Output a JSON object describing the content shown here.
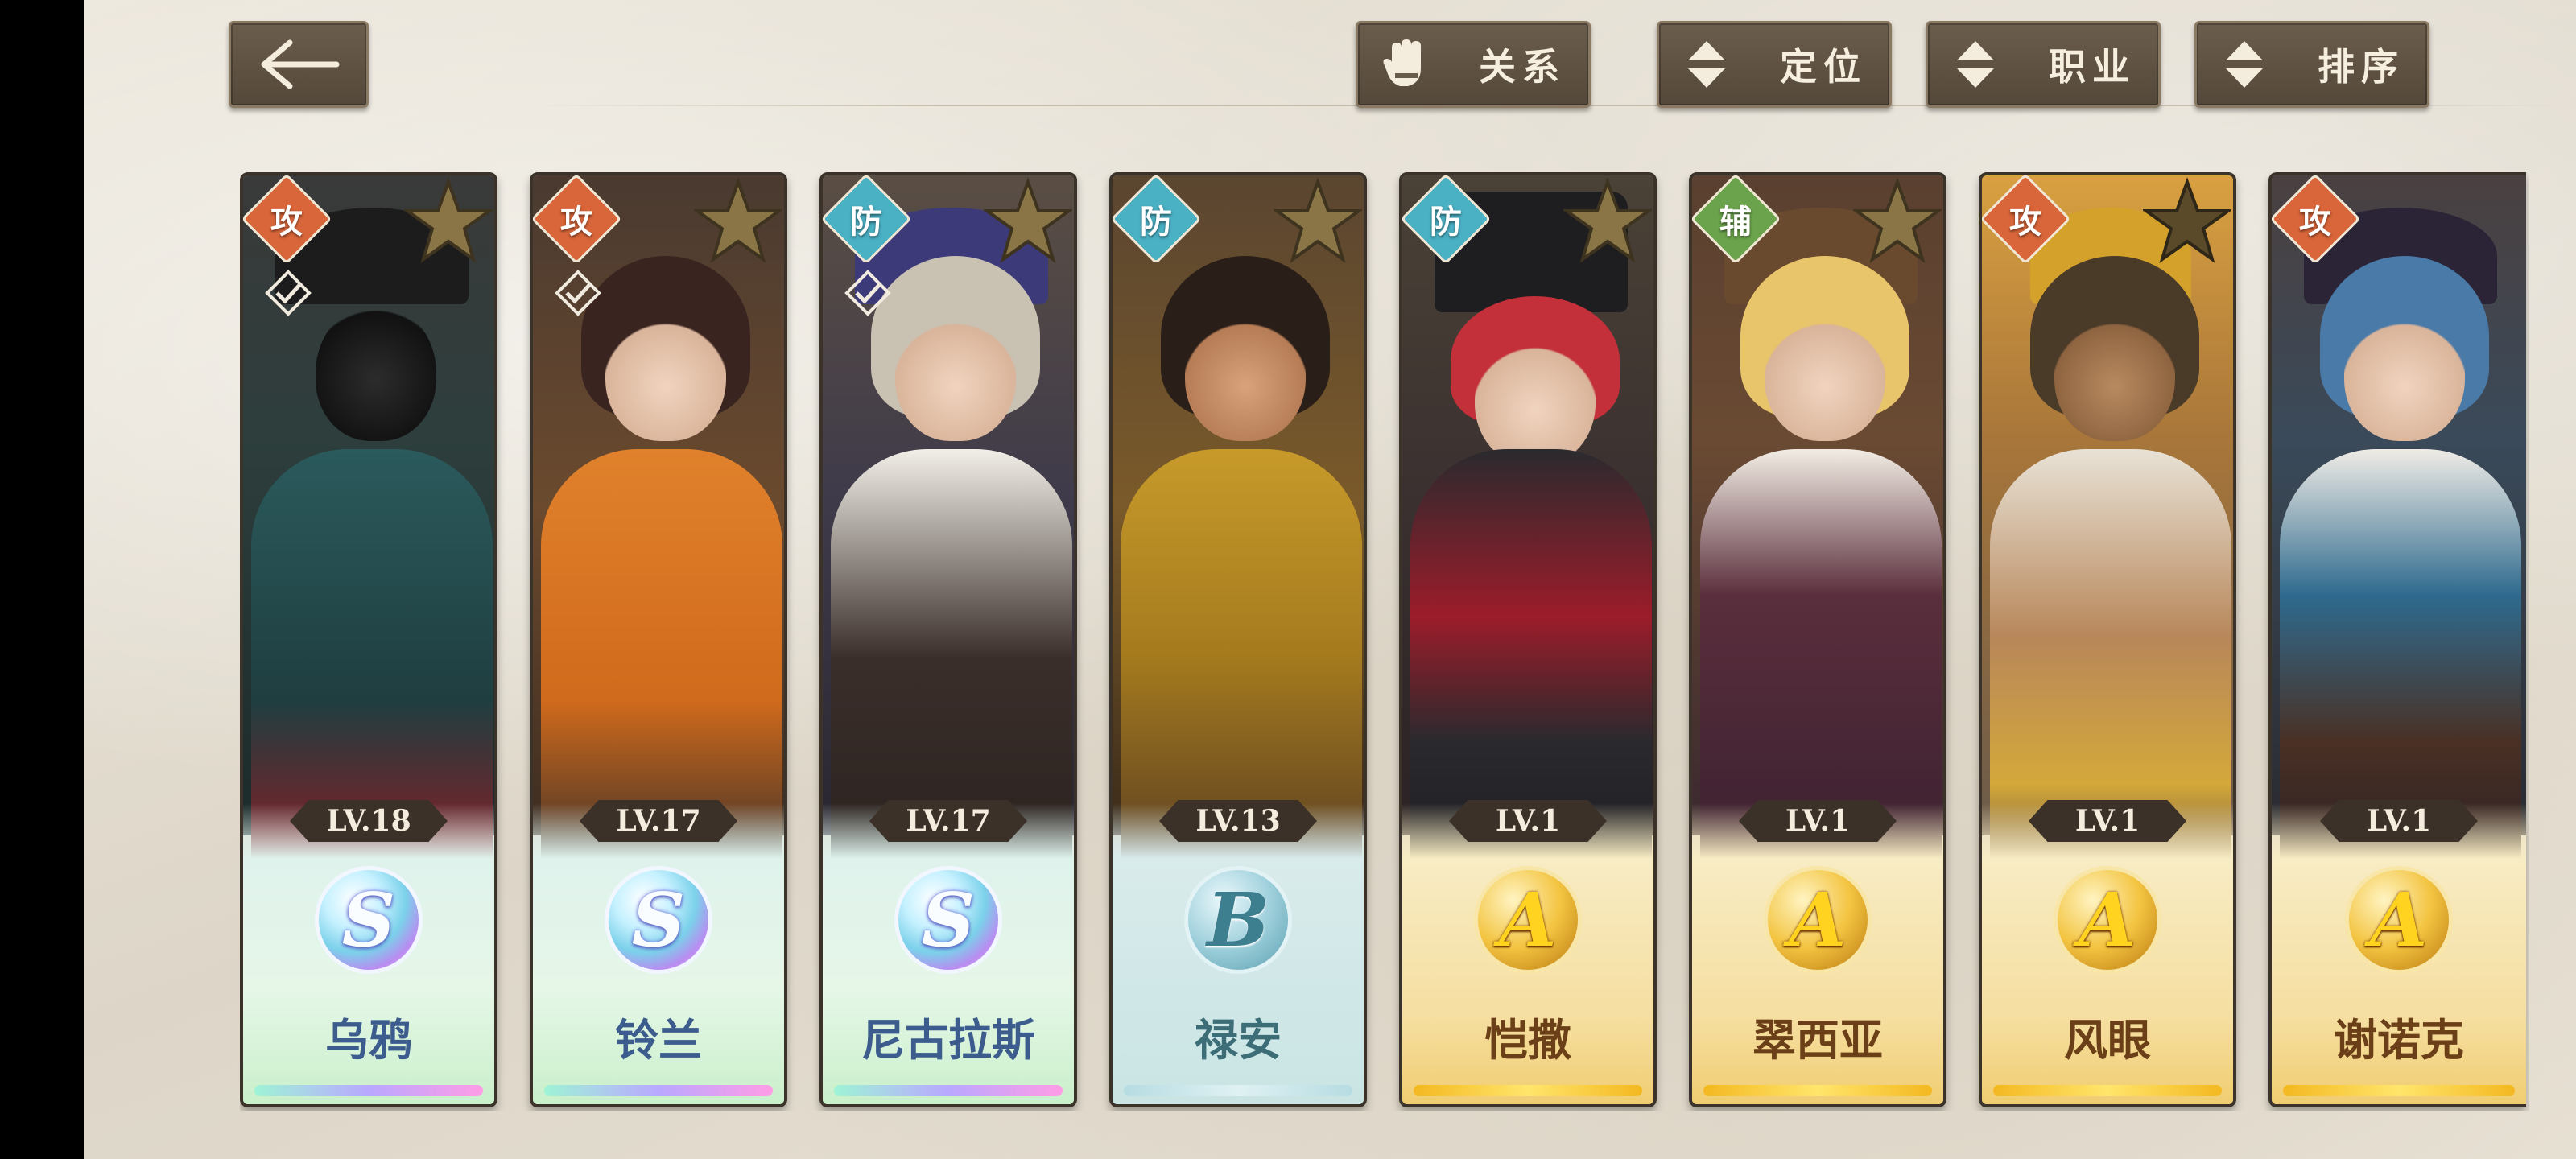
{
  "toolbar": {
    "back_icon": "arrow-left-icon",
    "filters": [
      {
        "label": "关系",
        "icon": "gauntlet-icon"
      },
      {
        "label": "定位",
        "icon": "sort-arrows-icon"
      },
      {
        "label": "职业",
        "icon": "sort-arrows-icon"
      },
      {
        "label": "排序",
        "icon": "sort-arrows-icon"
      }
    ]
  },
  "colors": {
    "attack": "#d9663a",
    "defense": "#4ab0c4",
    "support": "#6aa34b",
    "button": "#5f5242"
  },
  "characters": [
    {
      "role": "攻",
      "role_type": "attack",
      "level": "LV.18",
      "grade": "S",
      "name": "乌鸦",
      "selected": true
    },
    {
      "role": "攻",
      "role_type": "attack",
      "level": "LV.17",
      "grade": "S",
      "name": "铃兰",
      "selected": true
    },
    {
      "role": "防",
      "role_type": "defense",
      "level": "LV.17",
      "grade": "S",
      "name": "尼古拉斯",
      "selected": true
    },
    {
      "role": "防",
      "role_type": "defense",
      "level": "LV.13",
      "grade": "B",
      "name": "禄安",
      "selected": false
    },
    {
      "role": "防",
      "role_type": "defense",
      "level": "LV.1",
      "grade": "A",
      "name": "恺撒",
      "selected": false
    },
    {
      "role": "辅",
      "role_type": "support",
      "level": "LV.1",
      "grade": "A",
      "name": "翠西亚",
      "selected": false
    },
    {
      "role": "攻",
      "role_type": "attack",
      "level": "LV.1",
      "grade": "A",
      "name": "风眼",
      "selected": false
    },
    {
      "role": "攻",
      "role_type": "attack",
      "level": "LV.1",
      "grade": "A",
      "name": "谢诺克",
      "selected": false
    }
  ]
}
